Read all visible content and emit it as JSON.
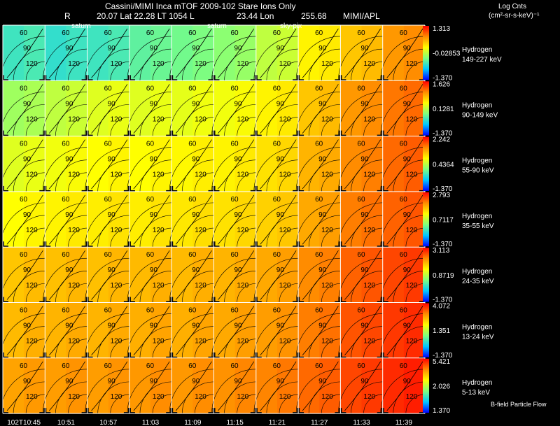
{
  "header": {
    "title": "Cassini/MIMI Inca mTOF  2009-102   Stare    Ions Only",
    "r_label": "R",
    "geometry": "20.07 Lat 22.28 LT 1054 L",
    "lon": "23.44 Lon",
    "extra": "255.68",
    "source": "MIMI/APL",
    "overlay_labels": [
      "saturn",
      "saturn",
      "sky-pix"
    ]
  },
  "units": {
    "title": "Log Cnts",
    "label": "(cm²-sr-s-keV)⁻¹"
  },
  "footer_note": "B-field Particle Flow",
  "colors": {
    "background": "#000000",
    "grid": "#ffffff",
    "contour": "#000000"
  },
  "chart_data": {
    "type": "heatmap",
    "x_tick_labels": [
      "102T10:45",
      "10:51",
      "10:57",
      "11:03",
      "11:09",
      "11:15",
      "11:21",
      "11:27",
      "11:33",
      "11:39"
    ],
    "contour_labels": [
      "60",
      "90",
      "120"
    ],
    "colormap": "rainbow",
    "rows": [
      {
        "species": "Hydrogen",
        "energy": "149-227 keV",
        "max": "1.313",
        "mid": "-0.02853",
        "min": "-1.370",
        "levels": [
          0.3,
          0.28,
          0.3,
          0.35,
          0.38,
          0.42,
          0.5,
          0.62,
          0.7,
          0.78
        ]
      },
      {
        "species": "Hydrogen",
        "energy": "90-149 keV",
        "max": "1.626",
        "mid": "0.1281",
        "min": "-1.370",
        "levels": [
          0.45,
          0.5,
          0.55,
          0.55,
          0.56,
          0.58,
          0.62,
          0.7,
          0.78,
          0.83
        ]
      },
      {
        "species": "Hydrogen",
        "energy": "55-90 keV",
        "max": "2.242",
        "mid": "0.4364",
        "min": "-1.370",
        "levels": [
          0.55,
          0.58,
          0.6,
          0.6,
          0.61,
          0.62,
          0.65,
          0.73,
          0.8,
          0.85
        ]
      },
      {
        "species": "Hydrogen",
        "energy": "35-55 keV",
        "max": "2.793",
        "mid": "0.7117",
        "min": "-1.370",
        "levels": [
          0.6,
          0.62,
          0.63,
          0.63,
          0.64,
          0.65,
          0.68,
          0.75,
          0.82,
          0.86
        ]
      },
      {
        "species": "Hydrogen",
        "energy": "24-35 keV",
        "max": "3.113",
        "mid": "0.8719",
        "min": "-1.370",
        "levels": [
          0.7,
          0.71,
          0.71,
          0.72,
          0.72,
          0.73,
          0.75,
          0.8,
          0.86,
          0.9
        ]
      },
      {
        "species": "Hydrogen",
        "energy": "13-24 keV",
        "max": "4.072",
        "mid": "1.351",
        "min": "-1.370",
        "levels": [
          0.72,
          0.73,
          0.73,
          0.74,
          0.74,
          0.75,
          0.77,
          0.82,
          0.88,
          0.92
        ]
      },
      {
        "species": "Hydrogen",
        "energy": "5-13 keV",
        "max": "5.421",
        "mid": "2.026",
        "min": "1.370",
        "levels": [
          0.76,
          0.77,
          0.77,
          0.78,
          0.78,
          0.79,
          0.81,
          0.85,
          0.9,
          0.94
        ]
      }
    ]
  }
}
